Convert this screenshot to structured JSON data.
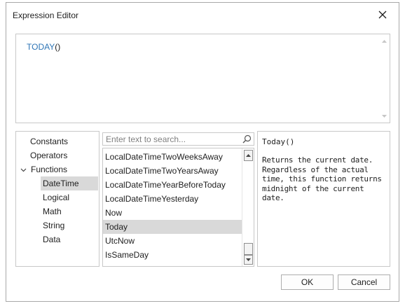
{
  "dialog": {
    "title": "Expression Editor"
  },
  "editor": {
    "function_name": "TODAY",
    "parens": "()"
  },
  "categories": [
    {
      "label": "Constants"
    },
    {
      "label": "Operators"
    },
    {
      "label": "Functions"
    },
    {
      "label": "DateTime"
    },
    {
      "label": "Logical"
    },
    {
      "label": "Math"
    },
    {
      "label": "String"
    },
    {
      "label": "Data"
    }
  ],
  "search": {
    "placeholder": "Enter text to search..."
  },
  "functions": [
    {
      "label": "LocalDateTimeTwoWeeksAway"
    },
    {
      "label": "LocalDateTimeTwoYearsAway"
    },
    {
      "label": "LocalDateTimeYearBeforeToday"
    },
    {
      "label": "LocalDateTimeYesterday"
    },
    {
      "label": "Now"
    },
    {
      "label": "Today"
    },
    {
      "label": "UtcNow"
    },
    {
      "label": "IsSameDay"
    }
  ],
  "description": {
    "signature": "Today()",
    "text": "Returns the current date. Regardless of the actual time, this function returns midnight of the current date."
  },
  "buttons": {
    "ok": "OK",
    "cancel": "Cancel"
  },
  "colors": {
    "function_token": "#2e75b6",
    "selection": "#d9d9d9",
    "border": "#c8c8c8"
  }
}
